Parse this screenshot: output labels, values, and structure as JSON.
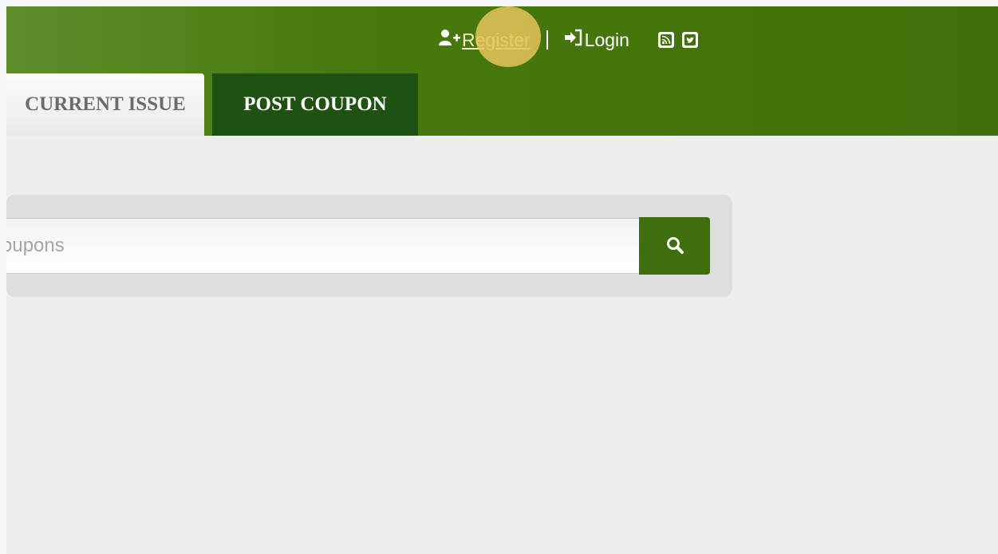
{
  "header": {
    "links": {
      "register_label": "Register",
      "login_label": "Login"
    },
    "icons": {
      "register": "user-plus-icon",
      "login": "sign-in-icon",
      "rss": "rss-icon",
      "twitter": "twitter-icon"
    }
  },
  "nav": {
    "tabs": [
      {
        "label": "CURRENT ISSUE"
      },
      {
        "label": "POST COUPON"
      }
    ]
  },
  "search": {
    "placeholder": "oupons",
    "button_icon": "search-icon"
  },
  "colors": {
    "header_green": "#47790c",
    "tab_dark_green": "#1f5110",
    "search_button": "#3f6f0c",
    "highlight": "#e5c45b"
  }
}
